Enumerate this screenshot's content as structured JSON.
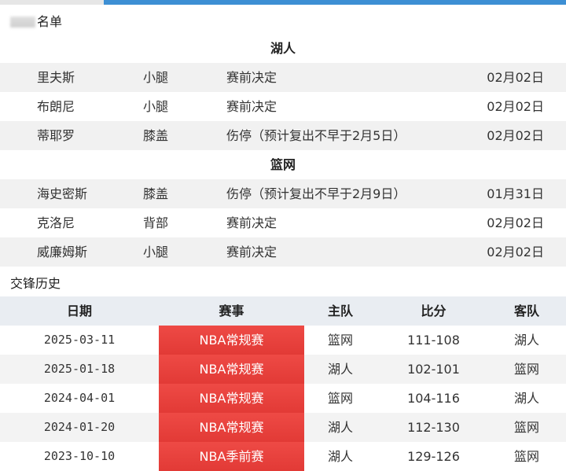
{
  "injury_section": {
    "label": "名单",
    "teams": [
      {
        "name": "湖人",
        "players": [
          {
            "name": "里夫斯",
            "part": "小腿",
            "status": "赛前决定",
            "date": "02月02日"
          },
          {
            "name": "布朗尼",
            "part": "小腿",
            "status": "赛前决定",
            "date": "02月02日"
          },
          {
            "name": "蒂耶罗",
            "part": "膝盖",
            "status": "伤停（预计复出不早于2月5日）",
            "date": "02月02日"
          }
        ]
      },
      {
        "name": "篮网",
        "players": [
          {
            "name": "海史密斯",
            "part": "膝盖",
            "status": "伤停（预计复出不早于2月9日）",
            "date": "01月31日"
          },
          {
            "name": "克洛尼",
            "part": "背部",
            "status": "赛前决定",
            "date": "02月02日"
          },
          {
            "name": "威廉姆斯",
            "part": "小腿",
            "status": "赛前决定",
            "date": "02月02日"
          }
        ]
      }
    ]
  },
  "history_section": {
    "label": "交锋历史",
    "headers": {
      "date": "日期",
      "event": "赛事",
      "home": "主队",
      "score": "比分",
      "away": "客队"
    },
    "rows": [
      {
        "date": "2025-03-11",
        "event": "NBA常规赛",
        "home": "篮网",
        "score": "111-108",
        "away": "湖人"
      },
      {
        "date": "2025-01-18",
        "event": "NBA常规赛",
        "home": "湖人",
        "score": "102-101",
        "away": "篮网"
      },
      {
        "date": "2024-04-01",
        "event": "NBA常规赛",
        "home": "篮网",
        "score": "104-116",
        "away": "湖人"
      },
      {
        "date": "2024-01-20",
        "event": "NBA常规赛",
        "home": "湖人",
        "score": "112-130",
        "away": "篮网"
      },
      {
        "date": "2023-10-10",
        "event": "NBA季前赛",
        "home": "湖人",
        "score": "129-126",
        "away": "篮网"
      }
    ]
  },
  "colors": {
    "accent_tab": "#3d8fd4",
    "event_cell": "#e23a36"
  }
}
